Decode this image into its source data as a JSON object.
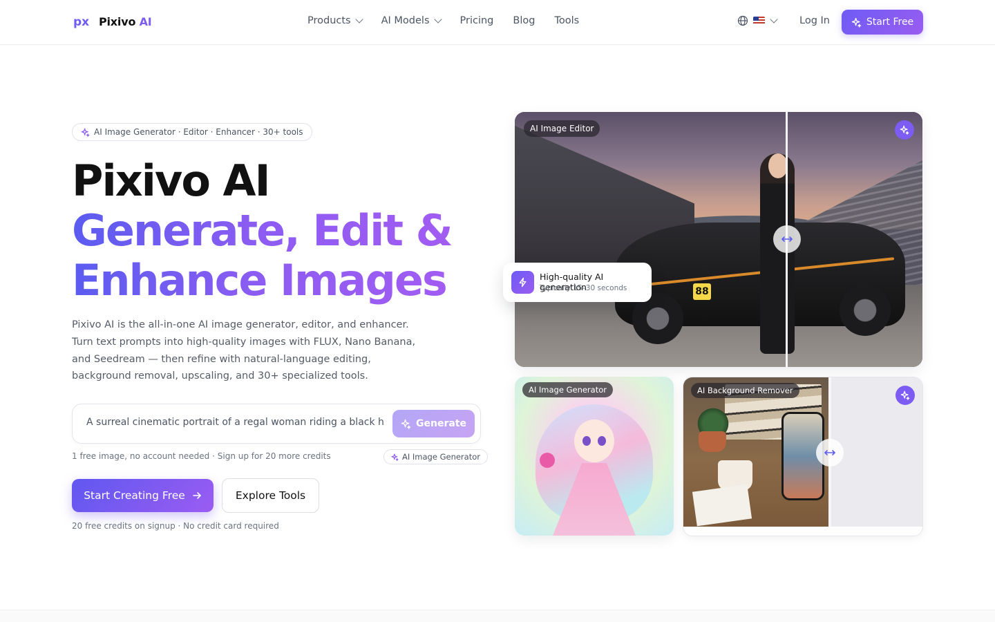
{
  "brand": {
    "name": "Pixivo",
    "name_accent": "AI",
    "mark": "px"
  },
  "nav": {
    "links": [
      {
        "label": "Products",
        "has_dropdown": true
      },
      {
        "label": "AI Models",
        "has_dropdown": true
      },
      {
        "label": "Pricing",
        "has_dropdown": false
      },
      {
        "label": "Blog",
        "has_dropdown": false
      },
      {
        "label": "Tools",
        "has_dropdown": false
      }
    ],
    "language_icon": "globe-icon",
    "flag": "US",
    "login_label": "Log In",
    "start_free_label": "Start Free"
  },
  "hero": {
    "pill": "AI Image Generator · Editor · Enhancer · 30+ tools",
    "title_line1": "Pixivo AI",
    "title_line2": "Generate, Edit &",
    "title_line3": "Enhance Images",
    "description": "Pixivo AI is the all-in-one AI image generator, editor, and enhancer. Turn text prompts into high-quality images with FLUX, Nano Banana, and Seedream — then refine with natural-language editing, background removal, upscaling, and 30+ specialized tools.",
    "prompt_value": "A surreal cinematic portrait of a regal woman riding a black hors",
    "generate_label": "Generate",
    "free_note": "1 free image, no account needed · Sign up for 20 more credits",
    "mode_pill": "AI Image Generator",
    "cta_primary": "Start Creating Free",
    "cta_secondary": "Explore Tools",
    "credits_note": "20 free credits on signup · No credit card required"
  },
  "showcase": {
    "main_tag": "AI Image Editor",
    "floating_title": "High-quality AI generation",
    "floating_sub": "Typically 15–30 seconds",
    "car_number": "88",
    "anime_tag": "AI Image Generator",
    "bg_tag": "AI Background Remover"
  },
  "colors": {
    "accent": "#7c5cf2",
    "accent_start": "#5f58f0",
    "accent_end": "#9b5cf2"
  }
}
